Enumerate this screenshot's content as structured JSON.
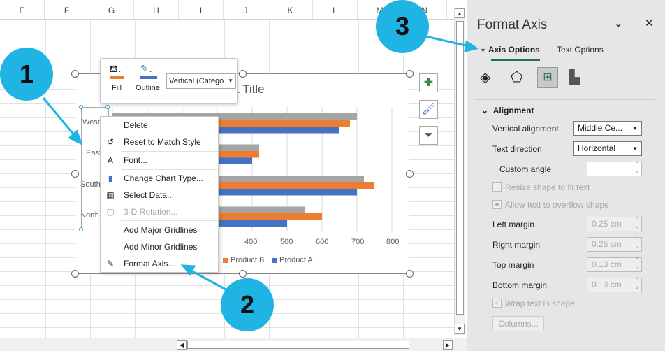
{
  "sheet": {
    "columns": [
      "E",
      "F",
      "G",
      "H",
      "I",
      "J",
      "K",
      "L",
      "M",
      "N"
    ]
  },
  "chart": {
    "title_visible": "t Title"
  },
  "chart_data": {
    "type": "bar",
    "orientation": "horizontal",
    "categories": [
      "West",
      "East",
      "South",
      "North"
    ],
    "series": [
      {
        "values": [
          700,
          420,
          720,
          550
        ],
        "color": "#a5a5a5"
      },
      {
        "name": "Product B",
        "values": [
          680,
          420,
          750,
          600
        ],
        "color": "#ed7d31"
      },
      {
        "name": "Product A",
        "values": [
          650,
          400,
          700,
          500
        ],
        "color": "#4472c4"
      }
    ],
    "xlim": [
      0,
      800
    ],
    "xticks_visible": [
      "400",
      "500",
      "600",
      "700",
      "800"
    ],
    "grid": true,
    "legend": "bottom"
  },
  "mini_toolbar": {
    "fill": "Fill",
    "outline": "Outline",
    "element_select": "Vertical (Catego"
  },
  "context_menu": [
    {
      "label": "Delete",
      "icon": ""
    },
    {
      "label": "Reset to Match Style",
      "icon": "reset-style-icon"
    },
    {
      "label": "Font...",
      "icon": "font-icon"
    },
    {
      "label": "Change Chart Type...",
      "icon": "chart-type-icon"
    },
    {
      "label": "Select Data...",
      "icon": "select-data-icon"
    },
    {
      "label": "3-D Rotation...",
      "icon": "3d-rotation-icon",
      "disabled": true
    },
    {
      "label": "Add Major Gridlines",
      "icon": ""
    },
    {
      "label": "Add Minor Gridlines",
      "icon": ""
    },
    {
      "label": "Format Axis...",
      "icon": "format-axis-icon"
    }
  ],
  "panel": {
    "title": "Format Axis",
    "tabs": [
      "Axis Options",
      "Text Options"
    ],
    "section": "Alignment",
    "vertical_alignment": {
      "label": "Vertical alignment",
      "value": "Middle Ce..."
    },
    "text_direction": {
      "label": "Text direction",
      "value": "Horizontal"
    },
    "custom_angle": {
      "label": "Custom angle",
      "value": ""
    },
    "resize": "Resize shape to fit text",
    "overflow": "Allow text to overflow shape",
    "left_margin": {
      "label": "Left margin",
      "value": "0.25 cm"
    },
    "right_margin": {
      "label": "Right margin",
      "value": "0.25 cm"
    },
    "top_margin": {
      "label": "Top margin",
      "value": "0.13 cm"
    },
    "bottom_margin": {
      "label": "Bottom margin",
      "value": "0.13 cm"
    },
    "wrap": "Wrap text in shape",
    "columns": "Columns..."
  },
  "callouts": [
    "1",
    "2",
    "3"
  ]
}
